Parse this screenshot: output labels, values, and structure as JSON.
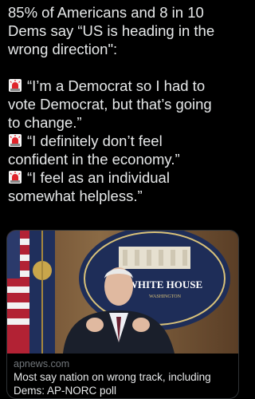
{
  "tweet": {
    "intro_lines": [
      "85% of Americans and 8 in 10",
      "Dems say “US is heading in the",
      "wrong direction\":"
    ],
    "quote1_lines": [
      "“I’m a Democrat so I had to",
      "vote Democrat, but that’s going",
      "to change.”"
    ],
    "quote2_lines": [
      "“I definitely don’t feel",
      "confident in the economy.”"
    ],
    "quote3_lines": [
      "“I feel as an individual",
      "somewhat helpless.”"
    ],
    "emoji_icon": "police-light-icon"
  },
  "card": {
    "image_sign_line1": "WHITE HOUSE",
    "image_sign_line2": "WASHINGTON",
    "domain": "apnews.com",
    "title_lines": [
      "Most say nation on wrong track, including",
      "Dems: AP-NORC poll"
    ]
  },
  "colors": {
    "background": "#000000",
    "text": "#e7e9ea",
    "muted": "#71767b",
    "border": "#2f3336",
    "siren": "#e0242b"
  }
}
